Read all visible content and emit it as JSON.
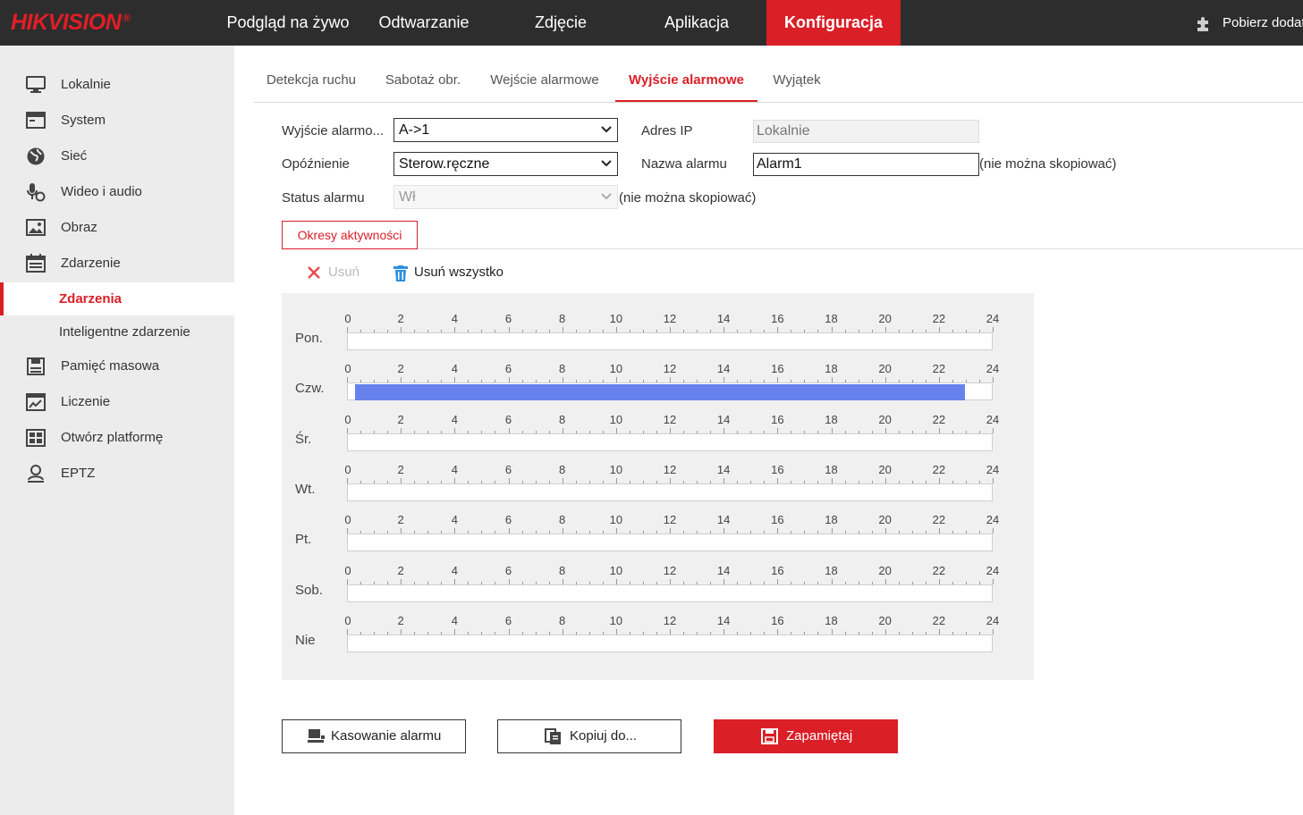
{
  "brand": {
    "logo": "HIKVISION",
    "registered": "®"
  },
  "topnav": {
    "items": [
      "Podgląd na żywo",
      "Odtwarzanie",
      "Zdjęcie",
      "Aplikacja",
      "Konfiguracja"
    ],
    "active_index": 4,
    "plugin_label": "Pobierz dodat"
  },
  "sidebar": {
    "items": [
      {
        "label": "Lokalnie",
        "icon": "monitor-icon"
      },
      {
        "label": "System",
        "icon": "window-icon"
      },
      {
        "label": "Sieć",
        "icon": "globe-icon"
      },
      {
        "label": "Wideo i audio",
        "icon": "microphone-camera-icon"
      },
      {
        "label": "Obraz",
        "icon": "image-icon"
      },
      {
        "label": "Zdarzenie",
        "icon": "calendar-icon"
      }
    ],
    "subitems": [
      {
        "label": "Zdarzenia",
        "active": true
      },
      {
        "label": "Inteligentne zdarzenie",
        "active": false
      }
    ],
    "items_after": [
      {
        "label": "Pamięć masowa",
        "icon": "save-disk-icon"
      },
      {
        "label": "Liczenie",
        "icon": "chart-icon"
      },
      {
        "label": "Otwórz platformę",
        "icon": "platform-icon"
      },
      {
        "label": "EPTZ",
        "icon": "person-icon"
      }
    ]
  },
  "tabs": {
    "items": [
      "Detekcja ruchu",
      "Sabotaż obr.",
      "Wejście alarmowe",
      "Wyjście alarmowe",
      "Wyjątek"
    ],
    "active_index": 3
  },
  "form": {
    "alarm_output_label": "Wyjście alarmo...",
    "alarm_output_value": "A->1",
    "ip_label": "Adres IP",
    "ip_value": "Lokalnie",
    "delay_label": "Opóźnienie",
    "delay_value": "Sterow.ręczne",
    "alarm_name_label": "Nazwa alarmu",
    "alarm_name_value": "Alarm1",
    "alarm_name_hint": "(nie można skopiować)",
    "status_label": "Status alarmu",
    "status_value": "Wł",
    "status_hint": "(nie można skopiować)"
  },
  "periods_button": "Okresy aktywności",
  "toolbar": {
    "delete_label": "Usuń",
    "delete_all_label": "Usuń wszystko"
  },
  "schedule": {
    "hour_ticks": [
      "0",
      "2",
      "4",
      "6",
      "8",
      "10",
      "12",
      "14",
      "16",
      "18",
      "20",
      "22",
      "24"
    ],
    "days": [
      {
        "label": "Pon.",
        "segments": []
      },
      {
        "label": "Czw.",
        "segments": [
          [
            0.25,
            23.0
          ]
        ]
      },
      {
        "label": "Śr.",
        "segments": []
      },
      {
        "label": "Wt.",
        "segments": []
      },
      {
        "label": "Pt.",
        "segments": []
      },
      {
        "label": "Sob.",
        "segments": []
      },
      {
        "label": "Nie",
        "segments": []
      }
    ],
    "segment_color": "#6782ec"
  },
  "buttons": {
    "reset_alarm": "Kasowanie alarmu",
    "copy_to": "Kopiuj do...",
    "save": "Zapamiętaj"
  },
  "colors": {
    "accent": "#da1f27",
    "topbar": "#2d2d2d",
    "sidebar": "#ececec"
  }
}
